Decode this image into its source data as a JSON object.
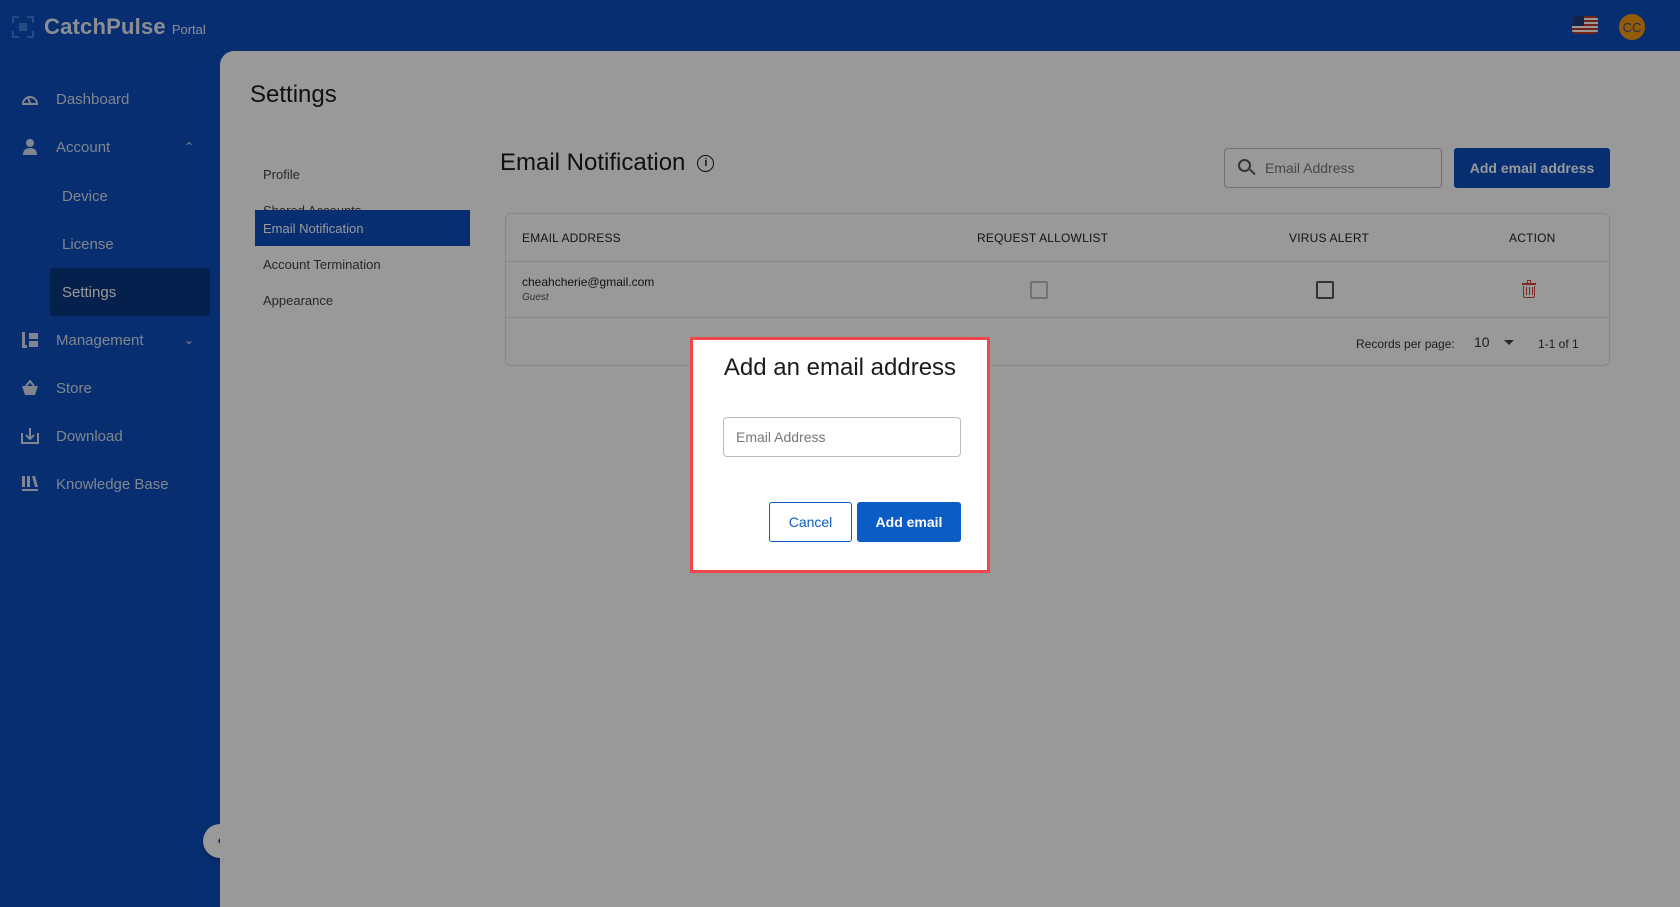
{
  "header": {
    "brand": "CatchPulse",
    "brand_sub": "Portal",
    "language_flag": "us-flag-icon",
    "avatar_initials": "CC",
    "avatar_color": "#f39a0c"
  },
  "sidebar": {
    "items": [
      {
        "label": "Dashboard",
        "icon": "dashboard-gauge-icon"
      },
      {
        "label": "Account",
        "icon": "user-icon",
        "expanded": true,
        "children": [
          {
            "label": "Device"
          },
          {
            "label": "License"
          },
          {
            "label": "Settings",
            "active": true
          }
        ]
      },
      {
        "label": "Management",
        "icon": "management-icon",
        "expanded": false
      },
      {
        "label": "Store",
        "icon": "basket-icon"
      },
      {
        "label": "Download",
        "icon": "download-icon"
      },
      {
        "label": "Knowledge Base",
        "icon": "library-icon"
      }
    ],
    "collapse_icon": "chevron-left-icon"
  },
  "settings": {
    "title": "Settings",
    "nav": [
      {
        "label": "Profile"
      },
      {
        "label": "Shared Accounts"
      },
      {
        "label": "Email Notification",
        "active": true
      },
      {
        "label": "Account Termination"
      },
      {
        "label": "Appearance"
      }
    ]
  },
  "email_notification": {
    "title": "Email Notification",
    "search_placeholder": "Email Address",
    "add_button": "Add email address",
    "table": {
      "columns": [
        "EMAIL ADDRESS",
        "REQUEST ALLOWLIST",
        "VIRUS ALERT",
        "ACTION"
      ],
      "rows": [
        {
          "email": "cheahcherie@gmail.com",
          "role": "Guest",
          "request_allowlist": false,
          "request_allowlist_disabled": true,
          "virus_alert": false
        }
      ]
    },
    "pagination": {
      "records_per_page_label": "Records per page:",
      "records_per_page": "10",
      "range": "1-1 of 1"
    }
  },
  "modal": {
    "title": "Add an email address",
    "input_placeholder": "Email Address",
    "cancel_label": "Cancel",
    "confirm_label": "Add email",
    "highlight_color": "#f0474d"
  },
  "colors": {
    "brand": "#0b4ebd",
    "primary_button": "#0b5cc4",
    "danger": "#d9443a"
  }
}
